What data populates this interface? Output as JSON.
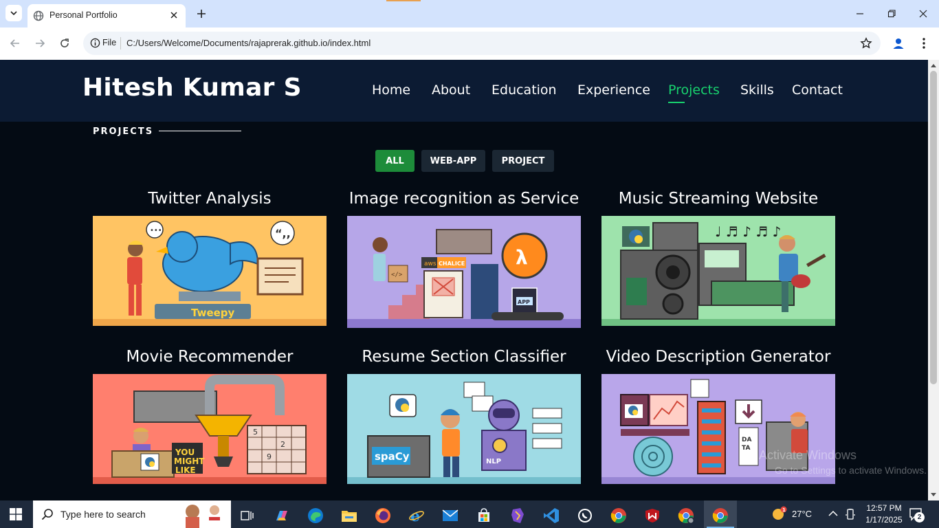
{
  "browser": {
    "tab_title": "Personal Portfolio",
    "omnibox_scheme": "File",
    "url": "C:/Users/Welcome/Documents/rajaprerak.github.io/index.html"
  },
  "site": {
    "logo": "Hitesh Kumar S",
    "nav": [
      "Home",
      "About",
      "Education",
      "Experience",
      "Projects",
      "Skills",
      "Contact"
    ],
    "active_nav": "Projects",
    "section_title": "PROJECTS",
    "filters": [
      "ALL",
      "WEB-APP",
      "PROJECT"
    ],
    "active_filter": "ALL",
    "projects": [
      {
        "title": "Twitter Analysis",
        "badge": "Tweepy",
        "bg": "#ffc463"
      },
      {
        "title": "Image recognition as Service",
        "badge": "aws",
        "badge2": "CHALICE",
        "badge3": "APP",
        "bg": "#b6a6e8"
      },
      {
        "title": "Music Streaming Website",
        "bg": "#9ee3ac"
      },
      {
        "title": "Movie Recommender",
        "badge": "YOU MIGHT LIKE",
        "bg": "#ff7f6e"
      },
      {
        "title": "Resume Section Classifier",
        "badge": "spaCy",
        "badge2": "NLP",
        "bg": "#9fdbe5"
      },
      {
        "title": "Video Description Generator",
        "badge": "DATA",
        "bg": "#b9a6ea"
      }
    ],
    "watermark_line1": "Activate Windows",
    "watermark_line2": "Go to Settings to activate Windows."
  },
  "taskbar": {
    "search_placeholder": "Type here to search",
    "temperature": "27°C",
    "time": "12:57 PM",
    "date": "1/17/2025",
    "notifications": "2"
  }
}
